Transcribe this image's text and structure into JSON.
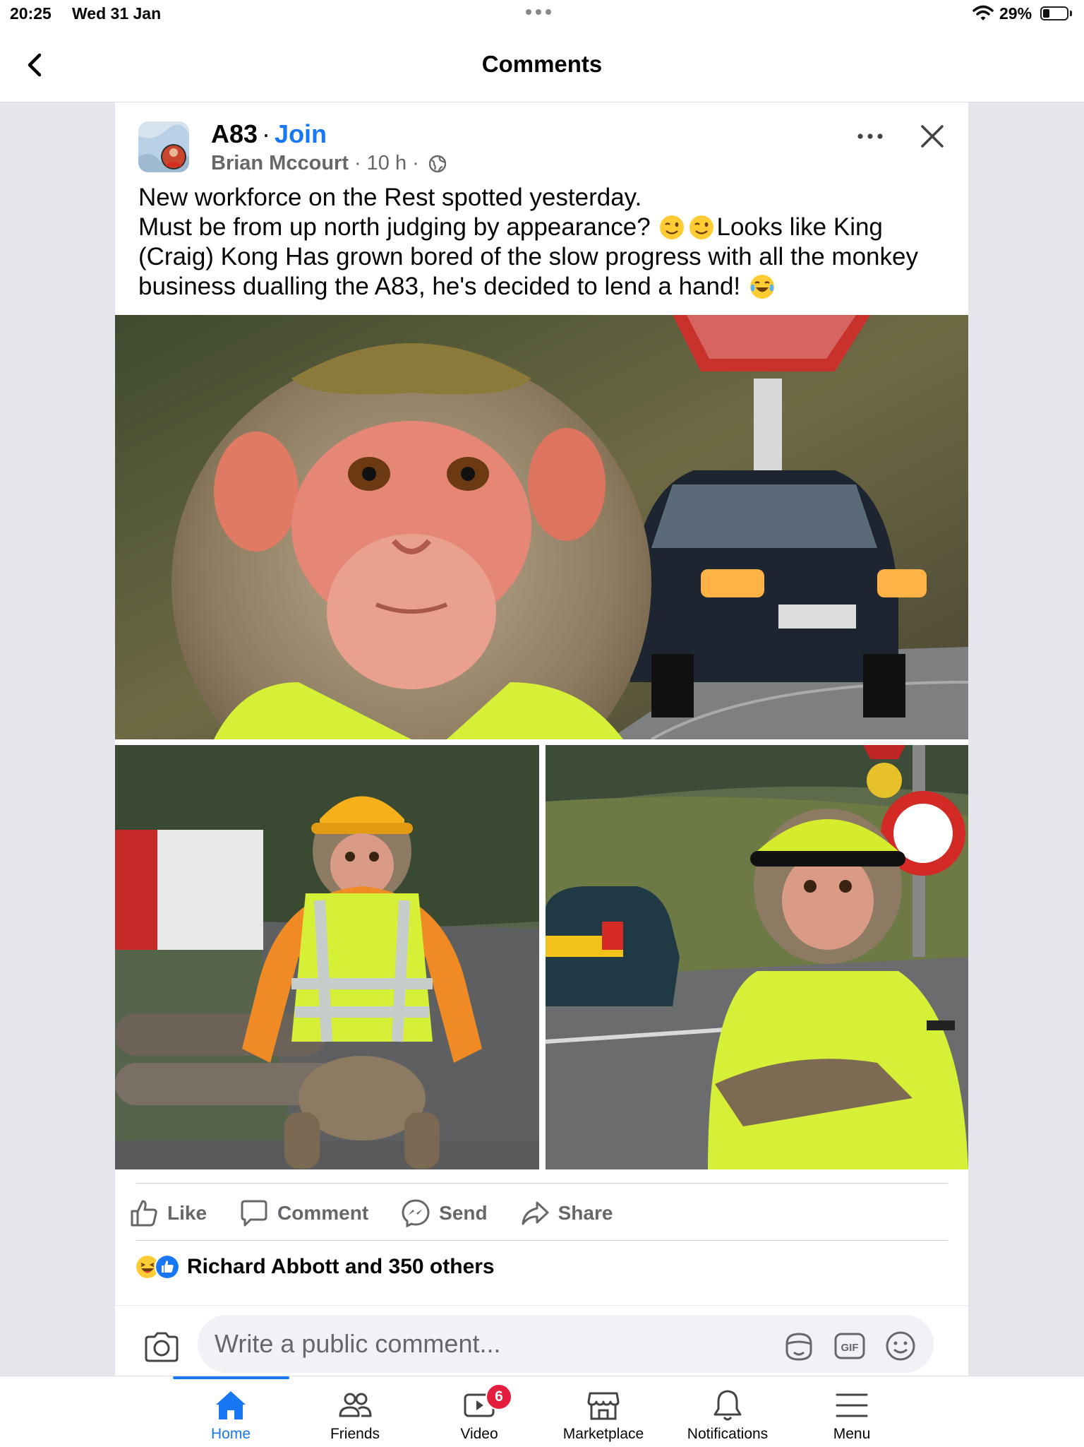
{
  "status_bar": {
    "time": "20:25",
    "date": "Wed 31 Jan",
    "battery_text": "29%",
    "battery_level": 0.29
  },
  "header": {
    "title": "Comments"
  },
  "post": {
    "group_name": "A83",
    "join_label": "Join",
    "author": "Brian Mccourt",
    "time_ago": "10 h",
    "text_line_1": "New workforce on the Rest spotted yesterday.",
    "text_line_2a": "Must be from up north judging by appearance?",
    "text_line_2b": "Looks like King",
    "text_line_3": "(Craig) Kong Has grown bored of the slow progress with all the monkey",
    "text_line_4": "business dualling the A83, he's decided to lend a hand!",
    "emojis": [
      "winking-face",
      "winking-face",
      "face-with-tears-of-joy"
    ],
    "images": [
      {
        "description_icon": "monkey-closeup-photo"
      },
      {
        "description_icon": "monkey-hi-vis-seated-photo"
      },
      {
        "description_icon": "monkey-hi-vis-roadside-photo"
      }
    ],
    "actions": {
      "like": "Like",
      "comment": "Comment",
      "send": "Send",
      "share": "Share"
    },
    "reactions_text": "Richard Abbott and 350 others",
    "comment_placeholder": "Write a public comment..."
  },
  "tabbar": {
    "tabs": [
      {
        "label": "Home",
        "icon": "home-icon",
        "active": true
      },
      {
        "label": "Friends",
        "icon": "friends-icon"
      },
      {
        "label": "Video",
        "icon": "video-icon",
        "badge": "6"
      },
      {
        "label": "Marketplace",
        "icon": "marketplace-icon"
      },
      {
        "label": "Notifications",
        "icon": "bell-icon"
      },
      {
        "label": "Menu",
        "icon": "menu-icon"
      }
    ]
  },
  "colors": {
    "accent": "#1877f2",
    "badge": "#e41e3f",
    "secondary_text": "#65676b",
    "page_bg": "#e4e6eb"
  }
}
